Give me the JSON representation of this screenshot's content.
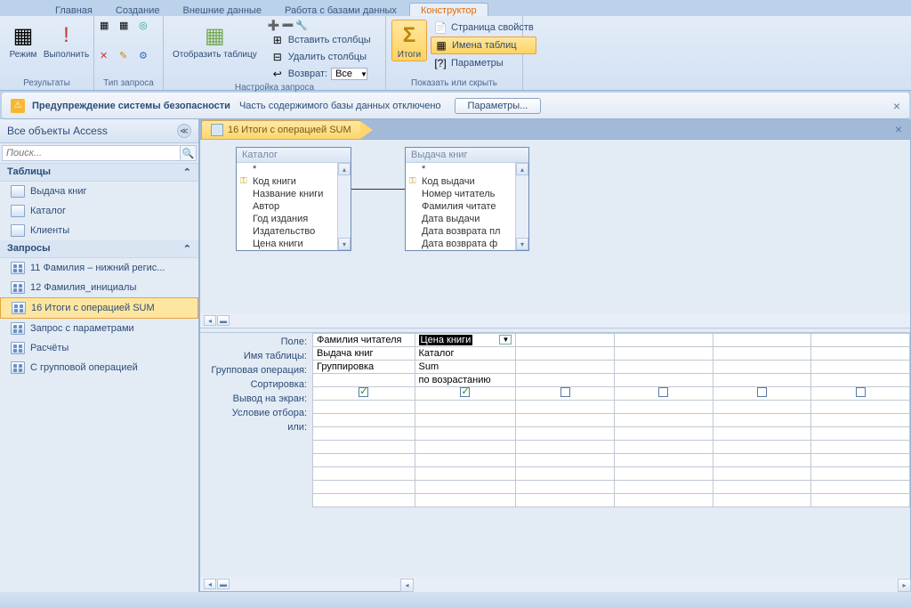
{
  "menu_tabs": [
    "Главная",
    "Создание",
    "Внешние данные",
    "Работа с базами данных",
    "Конструктор"
  ],
  "ribbon": {
    "results": {
      "label": "Результаты",
      "view": "Режим",
      "run": "Выполнить"
    },
    "query_type": {
      "label": "Тип запроса"
    },
    "setup": {
      "label": "Настройка запроса",
      "show_table": "Отобразить таблицу",
      "ins_cols": "Вставить столбцы",
      "del_cols": "Удалить столбцы",
      "return": "Возврат:",
      "return_val": "Все"
    },
    "totals": {
      "label": "Итоги"
    },
    "show_hide": {
      "label": "Показать или скрыть",
      "props": "Страница свойств",
      "names": "Имена таблиц",
      "params": "Параметры"
    }
  },
  "security": {
    "title": "Предупреждение системы безопасности",
    "msg": "Часть содержимого базы данных отключено",
    "btn": "Параметры...",
    "close": "×"
  },
  "nav": {
    "header": "Все объекты Access",
    "search_ph": "Поиск...",
    "tables": {
      "label": "Таблицы",
      "items": [
        "Выдача книг",
        "Каталог",
        "Клиенты"
      ]
    },
    "queries": {
      "label": "Запросы",
      "items": [
        "11 Фамилия – нижний регис...",
        "12 Фамилия_инициалы",
        "16 Итоги с операцией SUM",
        "Запрос с параметрами",
        "Расчёты",
        "С групповой операцией"
      ],
      "selected": 2
    }
  },
  "doc": {
    "title": "16 Итоги с операцией SUM"
  },
  "tables": {
    "catalog": {
      "name": "Каталог",
      "fields": [
        "*",
        "Код книги",
        "Название книги",
        "Автор",
        "Год издания",
        "Издательство",
        "Цена книги"
      ],
      "key": 1
    },
    "issue": {
      "name": "Выдача книг",
      "fields": [
        "*",
        "Код выдачи",
        "Номер читатель",
        "Фамилия читате",
        "Дата выдачи",
        "Дата возврата пл",
        "Дата возврата ф"
      ],
      "key": 1
    }
  },
  "grid": {
    "labels": [
      "Поле:",
      "Имя таблицы:",
      "Групповая операция:",
      "Сортировка:",
      "Вывод на экран:",
      "Условие отбора:",
      "или:"
    ],
    "cols": [
      {
        "field": "Фамилия читателя",
        "table": "Выдача книг",
        "group": "Группировка",
        "sort": "",
        "show": true
      },
      {
        "field": "Цена книги",
        "table": "Каталог",
        "group": "Sum",
        "sort": "по возрастанию",
        "show": true,
        "selected": true
      },
      {
        "field": "",
        "table": "",
        "group": "",
        "sort": "",
        "show": false
      },
      {
        "field": "",
        "table": "",
        "group": "",
        "sort": "",
        "show": false
      },
      {
        "field": "",
        "table": "",
        "group": "",
        "sort": "",
        "show": false
      },
      {
        "field": "",
        "table": "",
        "group": "",
        "sort": "",
        "show": false
      }
    ]
  }
}
